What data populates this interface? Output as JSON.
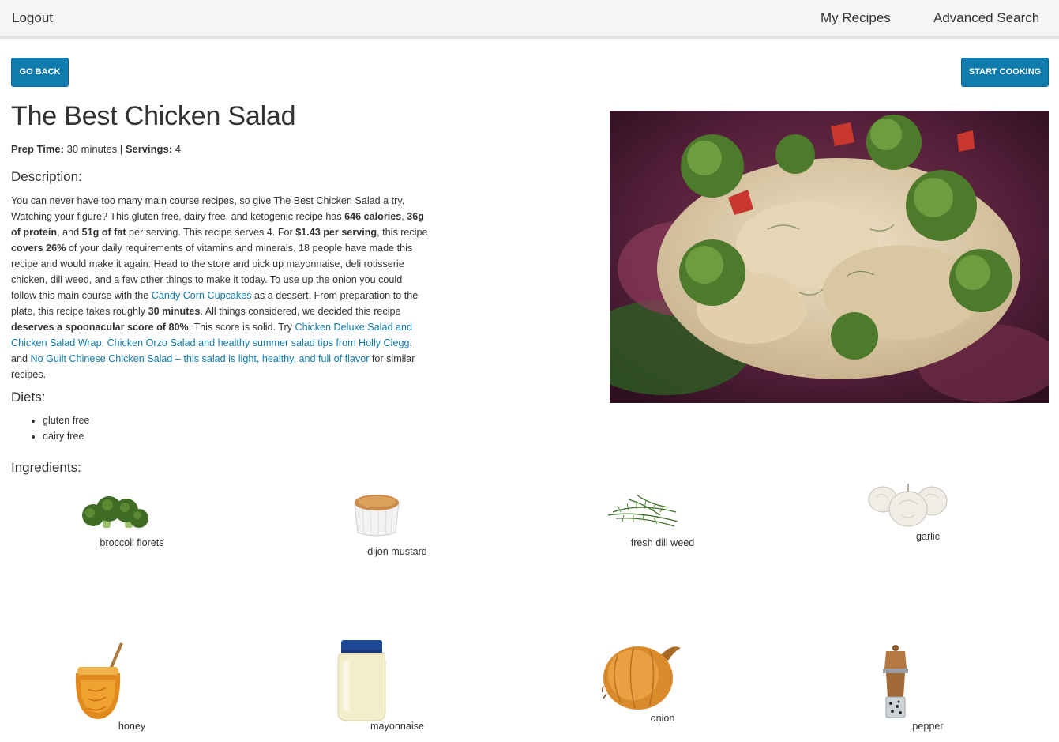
{
  "nav": {
    "logout": "Logout",
    "my_recipes": "My Recipes",
    "advanced_search": "Advanced Search"
  },
  "buttons": {
    "go_back": "GO BACK",
    "start_cooking": "START COOKING"
  },
  "recipe": {
    "title": "The Best Chicken Salad",
    "prep_label": "Prep Time:",
    "prep_value": "30 minutes",
    "separator": "|",
    "servings_label": "Servings:",
    "servings_value": "4"
  },
  "sections": {
    "description": "Description:",
    "diets": "Diets:",
    "ingredients": "Ingredients:"
  },
  "description": {
    "t1": "You can never have too many main course recipes, so give The Best Chicken Salad a try. Watching your figure? This gluten free, dairy free, and ketogenic recipe has ",
    "b1": "646 calories",
    "t2": ", ",
    "b2": "36g of protein",
    "t3": ", and ",
    "b3": "51g of fat",
    "t4": " per serving. This recipe serves 4. For ",
    "b4": "$1.43 per serving",
    "t5": ", this recipe ",
    "b5": "covers 26%",
    "t6": " of your daily requirements of vitamins and minerals. 18 people have made this recipe and would make it again. Head to the store and pick up mayonnaise, deli rotisserie chicken, dill weed, and a few other things to make it today. To use up the onion you could follow this main course with the ",
    "l1": "Candy Corn Cupcakes",
    "t7": " as a dessert. From preparation to the plate, this recipe takes roughly ",
    "b6": "30 minutes",
    "t8": ". All things considered, we decided this recipe ",
    "b7": "deserves a spoonacular score of 80%",
    "t9": ". This score is solid. Try ",
    "l2": "Chicken Deluxe Salad and Chicken Salad Wrap",
    "t10": ", ",
    "l3": "Chicken Orzo Salad and healthy summer salad tips from Holly Clegg",
    "t11": ", and ",
    "l4": "No Guilt Chinese Chicken Salad – this salad is light, healthy, and full of flavor",
    "t12": " for similar recipes."
  },
  "diets": [
    "gluten free",
    "dairy free"
  ],
  "ingredients": [
    {
      "name": "broccoli florets",
      "icon": "broccoli-icon"
    },
    {
      "name": "dijon mustard",
      "icon": "mustard-icon"
    },
    {
      "name": "fresh dill weed",
      "icon": "dill-icon"
    },
    {
      "name": "garlic",
      "icon": "garlic-icon"
    },
    {
      "name": "honey",
      "icon": "honey-icon"
    },
    {
      "name": "mayonnaise",
      "icon": "mayonnaise-icon"
    },
    {
      "name": "onion",
      "icon": "onion-icon"
    },
    {
      "name": "pepper",
      "icon": "pepper-mill-icon"
    }
  ],
  "colors": {
    "accent": "#0f7cad",
    "nav_bg": "#f5f5f5",
    "text": "#333333"
  }
}
